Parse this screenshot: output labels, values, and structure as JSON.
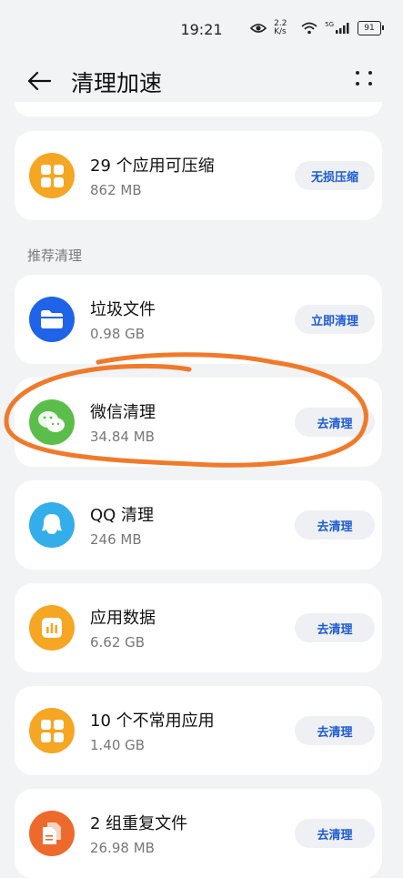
{
  "status_bar": {
    "time": "19:21",
    "net_speed": "2.2 K/s",
    "signal_label": "5G",
    "battery": "91"
  },
  "header": {
    "back_icon": "arrow-left-icon",
    "title": "清理加速",
    "more_icon": "more-dots-icon"
  },
  "compress_card": {
    "title": "29 个应用可压缩",
    "size": "862 MB",
    "button": "无损压缩",
    "icon": "apps-grid-icon",
    "icon_color": "#F5A623"
  },
  "section_title": "推荐清理",
  "items": [
    {
      "title": "垃圾文件",
      "size": "0.98 GB",
      "button": "立即清理",
      "icon": "folder-icon",
      "icon_color": "#1E63E8"
    },
    {
      "title": "微信清理",
      "size": "34.84 MB",
      "button": "去清理",
      "icon": "wechat-icon",
      "icon_color": "#5BBE4A"
    },
    {
      "title": "QQ 清理",
      "size": "246 MB",
      "button": "去清理",
      "icon": "qq-icon",
      "icon_color": "#33AEEA"
    },
    {
      "title": "应用数据",
      "size": "6.62 GB",
      "button": "去清理",
      "icon": "bar-chart-icon",
      "icon_color": "#F5A623"
    },
    {
      "title": "10 个不常用应用",
      "size": "1.40 GB",
      "button": "去清理",
      "icon": "apps-grid-icon",
      "icon_color": "#F5A623"
    },
    {
      "title": "2 组重复文件",
      "size": "26.98 MB",
      "button": "去清理",
      "icon": "duplicate-file-icon",
      "icon_color": "#EE6A2C"
    }
  ],
  "annotation": {
    "color": "#F07A2A",
    "highlighted_item": "微信清理"
  }
}
